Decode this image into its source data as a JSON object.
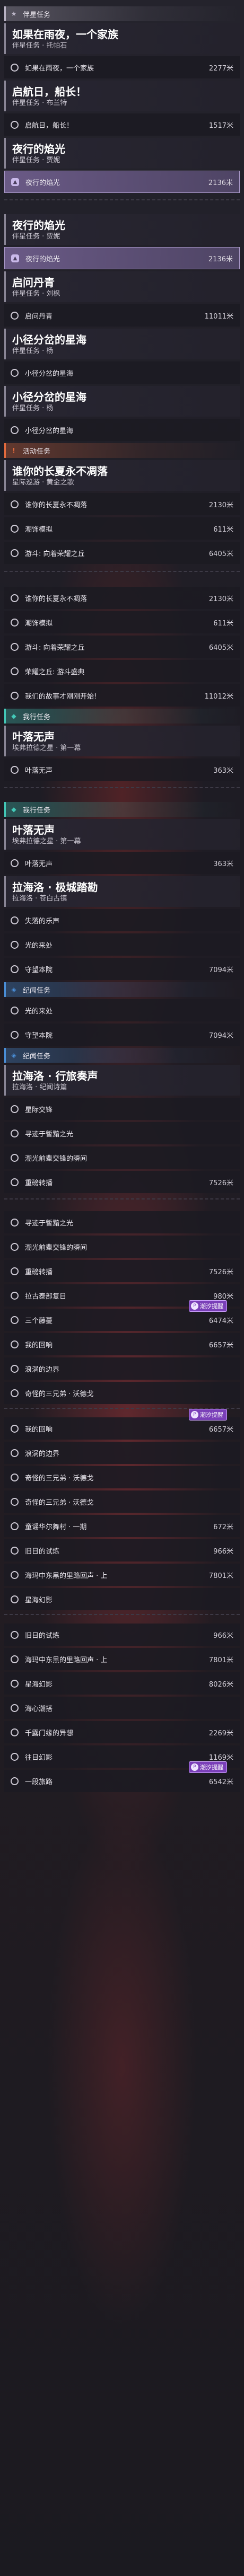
{
  "rows": [
    {
      "k": "sec",
      "kind": "companion",
      "label": "伴星任务",
      "icon": "star-icon",
      "icon_glyph": "★",
      "color": "#b9b3c4"
    },
    {
      "k": "card",
      "title": "如果在雨夜，一个家族",
      "subtitle": "伴星任务 · 托帕石"
    },
    {
      "k": "sub",
      "name": "如果在雨夜，一个家族",
      "dist": "2277米"
    },
    {
      "k": "card",
      "title": "启航日，船长！",
      "subtitle": "伴星任务 · 布兰特"
    },
    {
      "k": "sub",
      "name": "启航日，船长！",
      "dist": "1517米"
    },
    {
      "k": "card",
      "title": "夜行的焰光",
      "subtitle": "伴星任务 · 贾妮"
    },
    {
      "k": "sub",
      "name": "夜行的焰光",
      "dist": "2136米",
      "active": true
    },
    {
      "k": "spacer",
      "h": 24
    },
    {
      "k": "card",
      "title": "夜行的焰光",
      "subtitle": "伴星任务 · 贾妮"
    },
    {
      "k": "sub",
      "name": "夜行的焰光",
      "dist": "2136米",
      "active": true
    },
    {
      "k": "card",
      "title": "启问丹青",
      "subtitle": "伴星任务 · 刘枫"
    },
    {
      "k": "sub",
      "name": "启问丹青",
      "dist": "11011米"
    },
    {
      "k": "card",
      "title": "小径分岔的星海",
      "subtitle": "伴星任务 · 杨"
    },
    {
      "k": "sub",
      "name": "小径分岔的星海",
      "dist": ""
    },
    {
      "k": "card",
      "title": "小径分岔的星海",
      "subtitle": "伴星任务 · 杨"
    },
    {
      "k": "sub",
      "name": "小径分岔的星海",
      "dist": ""
    },
    {
      "k": "sec",
      "kind": "event",
      "label": "活动任务",
      "icon": "event-icon",
      "icon_glyph": "!",
      "color": "#e56b3d"
    },
    {
      "k": "card",
      "title": "谁你的长夏永不凋落",
      "subtitle": "星际巡游 · 黄金之歌"
    },
    {
      "k": "sub",
      "name": "谁你的长夏永不凋落",
      "dist": "2130米"
    },
    {
      "k": "sub",
      "name": "潮饰模拟",
      "dist": "611米"
    },
    {
      "k": "sub",
      "name": "游斗: 向着荣耀之丘",
      "dist": "6405米"
    },
    {
      "k": "spacer",
      "h": 26
    },
    {
      "k": "sub",
      "name": "谁你的长夏永不凋落",
      "dist": "2130米"
    },
    {
      "k": "sub",
      "name": "潮饰模拟",
      "dist": "611米"
    },
    {
      "k": "sub",
      "name": "游斗: 向着荣耀之丘",
      "dist": "6405米"
    },
    {
      "k": "sub",
      "name": "荣耀之丘: 游斗盛典",
      "dist": ""
    },
    {
      "k": "sub",
      "name": "我们的故事才刚刚开始!",
      "dist": "11012米"
    },
    {
      "k": "sec",
      "kind": "path",
      "label": "我行任务",
      "icon": "path-icon",
      "icon_glyph": "◆",
      "color": "#43c9b8"
    },
    {
      "k": "card",
      "title": "叶落无声",
      "subtitle": "埃弗拉德之星 · 第一幕"
    },
    {
      "k": "sub",
      "name": "叶落无声",
      "dist": "363米"
    },
    {
      "k": "spacer",
      "h": 24
    },
    {
      "k": "sec",
      "kind": "path",
      "label": "我行任务",
      "icon": "path-icon",
      "icon_glyph": "◆",
      "color": "#43c9b8"
    },
    {
      "k": "card",
      "title": "叶落无声",
      "subtitle": "埃弗拉德之星 · 第一幕"
    },
    {
      "k": "sub",
      "name": "叶落无声",
      "dist": "363米"
    },
    {
      "k": "card",
      "title": "拉海洛 · 极城踏勘",
      "subtitle": "拉海洛 · 苍白古镇"
    },
    {
      "k": "sub",
      "name": "失落的乐声",
      "dist": ""
    },
    {
      "k": "sub",
      "name": "光的来处",
      "dist": ""
    },
    {
      "k": "sub",
      "name": "守望本院",
      "dist": "7094米"
    },
    {
      "k": "sec",
      "kind": "record",
      "label": "纪闻任务",
      "icon": "record-icon",
      "icon_glyph": "◈",
      "color": "#4a8fd8"
    },
    {
      "k": "sub",
      "name": "光的来处",
      "dist": ""
    },
    {
      "k": "sub",
      "name": "守望本院",
      "dist": "7094米"
    },
    {
      "k": "sec",
      "kind": "record",
      "label": "纪闻任务",
      "icon": "record-icon",
      "icon_glyph": "◈",
      "color": "#4a8fd8"
    },
    {
      "k": "card",
      "title": "拉海洛 · 行旅奏声",
      "subtitle": "拉海洛 · 纪闻诗篇"
    },
    {
      "k": "sub",
      "name": "星际交锋",
      "dist": ""
    },
    {
      "k": "sub",
      "name": "寻迹于暂黯之光",
      "dist": ""
    },
    {
      "k": "sub",
      "name": "潮光前辈交锋的瞬间",
      "dist": ""
    },
    {
      "k": "sub",
      "name": "重磅转播",
      "dist": "7526米"
    },
    {
      "k": "spacer",
      "h": 20
    },
    {
      "k": "sub",
      "name": "寻迹于暂黯之光",
      "dist": ""
    },
    {
      "k": "sub",
      "name": "潮光前辈交锋的瞬间",
      "dist": ""
    },
    {
      "k": "sub",
      "name": "重磅转播",
      "dist": "7526米"
    },
    {
      "k": "sub",
      "name": "拉古泰部复日",
      "dist": "980米"
    },
    {
      "k": "sub",
      "name": "三个藤蔓",
      "dist": "6474米",
      "tag": true
    },
    {
      "k": "sub",
      "name": "我的回响",
      "dist": "6657米"
    },
    {
      "k": "sub",
      "name": "浪涡的边界",
      "dist": ""
    },
    {
      "k": "sub",
      "name": "奇怪的三兄弟 · 沃德戈",
      "dist": ""
    },
    {
      "k": "spacer",
      "h": 14
    },
    {
      "k": "sub",
      "name": "我的回响",
      "dist": "6657米",
      "tag": true
    },
    {
      "k": "sub",
      "name": "浪涡的边界",
      "dist": ""
    },
    {
      "k": "sub",
      "name": "奇怪的三兄弟 · 沃德戈",
      "dist": ""
    },
    {
      "k": "sub",
      "name": "奇怪的三兄弟 · 沃德戈",
      "dist": ""
    },
    {
      "k": "sub",
      "name": "童谣华尔舞村 · 一期",
      "dist": "672米"
    },
    {
      "k": "sub",
      "name": "旧日的试炼",
      "dist": "966米"
    },
    {
      "k": "sub",
      "name": "海玛中东黑的里路回声 · 上",
      "dist": "7801米"
    },
    {
      "k": "sub",
      "name": "星海幻影",
      "dist": ""
    },
    {
      "k": "spacer",
      "h": 14
    },
    {
      "k": "sub",
      "name": "旧日的试炼",
      "dist": "966米"
    },
    {
      "k": "sub",
      "name": "海玛中东黑的里路回声 · 上",
      "dist": "7801米"
    },
    {
      "k": "sub",
      "name": "星海幻影",
      "dist": "8026米"
    },
    {
      "k": "sub",
      "name": "海心潮搭",
      "dist": ""
    },
    {
      "k": "sub",
      "name": "千露门缘的异想",
      "dist": "2269米"
    },
    {
      "k": "sub",
      "name": "往日幻影",
      "dist": "1169米"
    },
    {
      "k": "sub",
      "name": "一段旅路",
      "dist": "6542米",
      "tag": true
    }
  ],
  "tag_label": "潮汐提醒",
  "tag_icon": "pin-icon",
  "tag_icon_glyph": "P",
  "active_icon": "locate-icon",
  "active_icon_glyph": "▲"
}
